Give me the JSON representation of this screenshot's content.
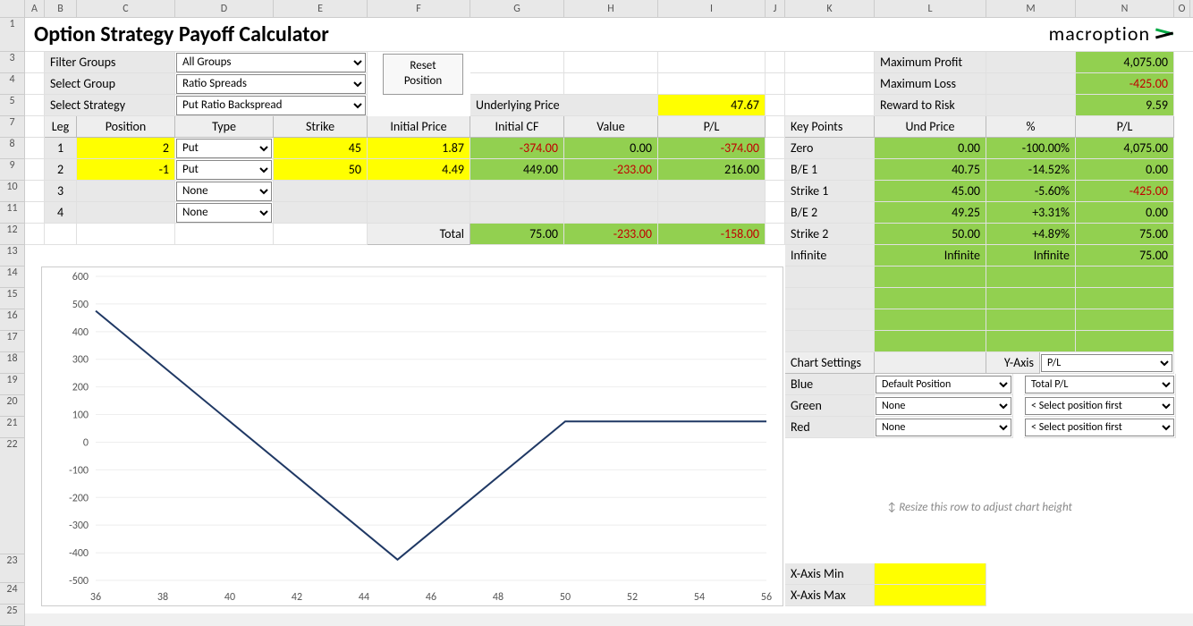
{
  "title": "Option Strategy Payoff Calculator",
  "brand": "macroption",
  "filters": {
    "filter_groups_label": "Filter Groups",
    "filter_groups_value": "All Groups",
    "select_group_label": "Select Group",
    "select_group_value": "Ratio Spreads",
    "select_strategy_label": "Select Strategy",
    "select_strategy_value": "Put Ratio Backspread"
  },
  "reset_btn": "Reset\nPosition",
  "underlying_label": "Underlying Price",
  "underlying_value": "47.67",
  "legs_header": {
    "leg": "Leg",
    "position": "Position",
    "type": "Type",
    "strike": "Strike",
    "initial_price": "Initial Price",
    "initial_cf": "Initial CF",
    "value": "Value",
    "pl": "P/L"
  },
  "legs": [
    {
      "n": "1",
      "pos": "2",
      "type": "Put",
      "strike": "45",
      "iprice": "1.87",
      "icf": "-374.00",
      "val": "0.00",
      "pl": "-374.00"
    },
    {
      "n": "2",
      "pos": "-1",
      "type": "Put",
      "strike": "50",
      "iprice": "4.49",
      "icf": "449.00",
      "val": "-233.00",
      "pl": "216.00"
    },
    {
      "n": "3",
      "pos": "",
      "type": "None",
      "strike": "",
      "iprice": "",
      "icf": "",
      "val": "",
      "pl": ""
    },
    {
      "n": "4",
      "pos": "",
      "type": "None",
      "strike": "",
      "iprice": "",
      "icf": "",
      "val": "",
      "pl": ""
    }
  ],
  "total_label": "Total",
  "totals": {
    "icf": "75.00",
    "val": "-233.00",
    "pl": "-158.00"
  },
  "summary": {
    "max_profit_label": "Maximum Profit",
    "max_profit": "4,075.00",
    "max_loss_label": "Maximum Loss",
    "max_loss": "-425.00",
    "rr_label": "Reward to Risk",
    "rr": "9.59"
  },
  "kp_header": {
    "kp": "Key Points",
    "up": "Und Price",
    "pct": "%",
    "pl": "P/L"
  },
  "key_points": [
    {
      "k": "Zero",
      "up": "0.00",
      "pct": "-100.00%",
      "pl": "4,075.00"
    },
    {
      "k": "B/E 1",
      "up": "40.75",
      "pct": "-14.52%",
      "pl": "0.00"
    },
    {
      "k": "Strike 1",
      "up": "45.00",
      "pct": "-5.60%",
      "pl": "-425.00"
    },
    {
      "k": "B/E 2",
      "up": "49.25",
      "pct": "+3.31%",
      "pl": "0.00"
    },
    {
      "k": "Strike 2",
      "up": "50.00",
      "pct": "+4.89%",
      "pl": "75.00"
    },
    {
      "k": "Infinite",
      "up": "Infinite",
      "pct": "Infinite",
      "pl": "75.00"
    }
  ],
  "chart_settings": {
    "label": "Chart Settings",
    "yaxis_label": "Y-Axis",
    "yaxis": "P/L",
    "blue_label": "Blue",
    "blue": "Default Position",
    "blue2": "Total P/L",
    "green_label": "Green",
    "green": "None",
    "green2": "< Select position first",
    "red_label": "Red",
    "red": "None",
    "red2": "< Select position first"
  },
  "resize_hint": "Resize this row to adjust chart height",
  "xaxis": {
    "min_label": "X-Axis Min",
    "max_label": "X-Axis Max"
  },
  "cols": [
    "A",
    "B",
    "C",
    "D",
    "E",
    "F",
    "G",
    "H",
    "I",
    "J",
    "K",
    "L",
    "M",
    "N",
    "O"
  ],
  "row_nums": [
    "1",
    "3",
    "4",
    "5",
    "7",
    "8",
    "9",
    "10",
    "11",
    "12",
    "13",
    "14",
    "15",
    "16",
    "17",
    "18",
    "19",
    "20",
    "21",
    "22",
    "23",
    "24",
    "25"
  ],
  "chart_data": {
    "type": "line",
    "title": "",
    "xlabel": "",
    "ylabel": "",
    "xlim": [
      36,
      56
    ],
    "ylim": [
      -500,
      600
    ],
    "yticks": [
      -500,
      -400,
      -300,
      -200,
      -100,
      0,
      100,
      200,
      300,
      400,
      500,
      600
    ],
    "xticks": [
      36,
      38,
      40,
      42,
      44,
      46,
      48,
      50,
      52,
      54,
      56
    ],
    "series": [
      {
        "name": "Total P/L",
        "color": "#1f3864",
        "x": [
          36,
          45,
          50,
          56
        ],
        "y": [
          475,
          -425,
          75,
          75
        ]
      }
    ]
  }
}
